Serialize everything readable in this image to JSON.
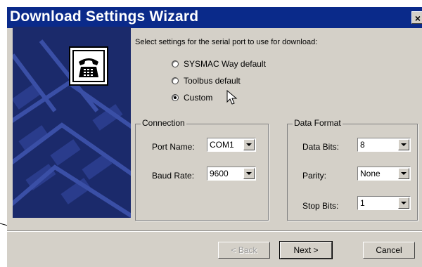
{
  "window": {
    "title": "Download Settings Wizard",
    "close_glyph": "×"
  },
  "wizard": {
    "prompt": "Select settings for the serial port to use for download:",
    "options": [
      {
        "label": "SYSMAC Way default",
        "checked": false
      },
      {
        "label": "Toolbus default",
        "checked": false
      },
      {
        "label": "Custom",
        "checked": true
      }
    ]
  },
  "connection": {
    "legend": "Connection",
    "port_label": "Port Name:",
    "port_value": "COM1",
    "baud_label": "Baud Rate:",
    "baud_value": "9600"
  },
  "data_format": {
    "legend": "Data Format",
    "bits_label": "Data Bits:",
    "bits_value": "8",
    "parity_label": "Parity:",
    "parity_value": "None",
    "stop_label": "Stop Bits:",
    "stop_value": "1"
  },
  "buttons": {
    "back": "< Back",
    "next": "Next >",
    "cancel": "Cancel"
  },
  "icons": {
    "side_icon": "telephone-icon",
    "cursor": "mouse-pointer-icon"
  },
  "colors": {
    "titlebar": "#0a2a8a",
    "side_panel": "#1b2a6b",
    "face": "#d4d0c8"
  }
}
